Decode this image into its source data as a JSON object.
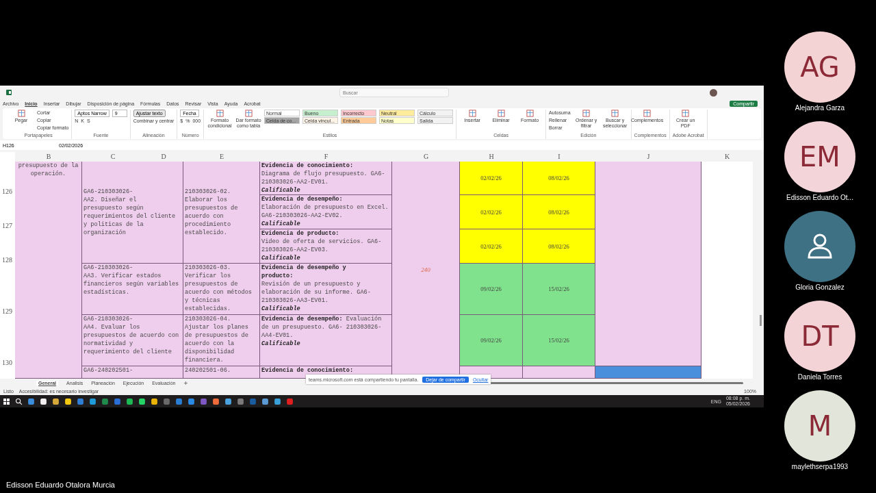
{
  "excel": {
    "search": {
      "placeholder": "Buscar"
    },
    "share_button": "Compartir",
    "menu_tabs": [
      {
        "label": "Archivo",
        "selected": false
      },
      {
        "label": "Inicio",
        "selected": true
      },
      {
        "label": "Insertar",
        "selected": false
      },
      {
        "label": "Dibujar",
        "selected": false
      },
      {
        "label": "Disposición de página",
        "selected": false
      },
      {
        "label": "Fórmulas",
        "selected": false
      },
      {
        "label": "Datos",
        "selected": false
      },
      {
        "label": "Revisar",
        "selected": false
      },
      {
        "label": "Vista",
        "selected": false
      },
      {
        "label": "Ayuda",
        "selected": false
      },
      {
        "label": "Acrobat",
        "selected": false
      }
    ],
    "ribbon": [
      {
        "label": "Portapapeles",
        "large": [
          {
            "label": "Pegar"
          }
        ],
        "lines": [
          {
            "items": [
              {
                "kind": "text",
                "label": "Cortar"
              }
            ]
          },
          {
            "items": [
              {
                "kind": "text",
                "label": "Copiar"
              }
            ]
          },
          {
            "items": [
              {
                "kind": "text",
                "label": "Copiar formato"
              }
            ]
          }
        ]
      },
      {
        "label": "Fuente",
        "lines": [
          {
            "items": [
              {
                "kind": "field",
                "label": "Aptos Narrow"
              },
              {
                "kind": "field",
                "label": "9"
              }
            ]
          },
          {
            "items": [
              {
                "kind": "text",
                "label": "N"
              },
              {
                "kind": "text",
                "label": "K"
              },
              {
                "kind": "text",
                "label": "S"
              }
            ]
          }
        ]
      },
      {
        "label": "Alineación",
        "lines": [
          {
            "items": [
              {
                "kind": "toggle",
                "label": "Ajustar texto"
              }
            ]
          },
          {
            "items": [
              {
                "kind": "text",
                "label": "Combinar y centrar"
              }
            ]
          }
        ]
      },
      {
        "label": "Número",
        "lines": [
          {
            "items": [
              {
                "kind": "field",
                "label": "Fecha"
              }
            ]
          },
          {
            "items": [
              {
                "kind": "text",
                "label": "$"
              },
              {
                "kind": "text",
                "label": "%"
              },
              {
                "kind": "text",
                "label": "000"
              }
            ]
          }
        ]
      },
      {
        "label": "Estilos",
        "large": [
          {
            "label": "Formato condicional"
          },
          {
            "label": "Dar formato como tabla"
          }
        ],
        "lines": [
          {
            "items": [
              {
                "kind": "style",
                "label": "Normal",
                "color": "#ffffff"
              },
              {
                "kind": "style",
                "label": "Bueno",
                "color": "#c6efce"
              },
              {
                "kind": "style",
                "label": "Incorrecto",
                "color": "#ffc7ce"
              },
              {
                "kind": "style",
                "label": "Neutral",
                "color": "#ffeb9c"
              },
              {
                "kind": "style",
                "label": "Cálculo",
                "color": "#f2f2f2"
              }
            ]
          },
          {
            "items": [
              {
                "kind": "style",
                "label": "Celda de co...",
                "color": "#a5a5a5"
              },
              {
                "kind": "style",
                "label": "Celda vincul...",
                "color": "#fdf3e7"
              },
              {
                "kind": "style",
                "label": "Entrada",
                "color": "#ffcc99"
              },
              {
                "kind": "style",
                "label": "Notas",
                "color": "#ffffcc"
              },
              {
                "kind": "style",
                "label": "Salida",
                "color": "#f2f2f2"
              }
            ]
          }
        ]
      },
      {
        "label": "Celdas",
        "large": [
          {
            "label": "Insertar"
          },
          {
            "label": "Eliminar"
          },
          {
            "label": "Formato"
          }
        ]
      },
      {
        "label": "Edición",
        "lines": [
          {
            "items": [
              {
                "kind": "text",
                "label": "Autosuma"
              }
            ]
          },
          {
            "items": [
              {
                "kind": "text",
                "label": "Rellenar"
              }
            ]
          },
          {
            "items": [
              {
                "kind": "text",
                "label": "Borrar"
              }
            ]
          }
        ],
        "large_after": [
          {
            "label": "Ordenar y filtrar"
          },
          {
            "label": "Buscar y seleccionar"
          }
        ]
      },
      {
        "label": "Complementos",
        "large": [
          {
            "label": "Complementos"
          }
        ]
      },
      {
        "label": "Adobe Acrobat",
        "large": [
          {
            "label": "Crear un PDF"
          }
        ]
      }
    ],
    "name_box": "H126",
    "formula": "02/02/2026",
    "sheet": {
      "columns": [
        "B",
        "C",
        "D",
        "E",
        "F",
        "G",
        "H",
        "I",
        "J",
        "K"
      ],
      "row_numbers": [
        "126",
        "127",
        "128",
        "129",
        "130"
      ],
      "outcome": "presupuesto de la\noperación.",
      "activities": [
        "GA6-210303026-\nAA2.  Diseñar el\npresupuesto según\nrequerimientos del cliente\ny politicas de la\norganización",
        "GA6-210303026-\nAA3. Verificar estados\nfinancieros según variables\nestadísticas.",
        "GA6-210303026-\nAA4. Evaluar los\npresupuestos de acuerdo con\nnormatividad y\nrequerimiento del cliente",
        "GA6-240202501-"
      ],
      "competencies": [
        "210303026-02.\nElaborar los\npresupuestos de\nacuerdo con\nprocedimiento\nestablecido.",
        "210303026-03.\nVerificar los\npresupuestos de\nacuerdo con métodos\ny técnicas\nestablecidas.",
        "210303026-04.\nAjustar los planes\nde presupuestos de\nacuerdo con la\ndisponibilidad\nfinanciera.",
        "240202501-06."
      ],
      "evidences": [
        {
          "text": "**Evidencia de conocimiento:**\nDiagrama de flujo presupuesto. GA6-\n210303026-AA2-EV01.",
          "note": "Calificable"
        },
        {
          "text": "**Evidencia de desempeño:**\nElaboración de presupuesto en Excel.\nGA6-210303026-AA2-EV02.",
          "note": "Calificable"
        },
        {
          "text": "**Evidencia de producto:**\nVideo de oferta de servicios. GA6-\n210303026-AA2-EV03.",
          "note": "Calificable"
        },
        {
          "text": "**Evidencia de desempeño y\nproducto:**\nRevisión de un presupuesto y\nelaboración de su informe. GA6-\n210303026-AA3-EV01.",
          "note": "Calificable"
        },
        {
          "text": "**Evidencia de desempeño:** Evaluación\nde un presupuesto. GA6- 210303026-\nAA4-EV01.",
          "note": "Calificable"
        },
        {
          "text": "**Evidencia de conocimiento:**"
        }
      ],
      "hours": "240",
      "start_dates": [
        {
          "text": "02/02/26",
          "color": "#ffff00"
        },
        {
          "text": "02/02/26",
          "color": "#ffff00"
        },
        {
          "text": "02/02/26",
          "color": "#ffff00"
        },
        {
          "text": "09/02/26",
          "color": "#80e28c"
        },
        {
          "text": "09/02/26",
          "color": "#80e28c"
        },
        {
          "color": "#efcdec"
        }
      ],
      "end_dates": [
        {
          "text": "08/02/26",
          "color": "#ffff00"
        },
        {
          "text": "08/02/26",
          "color": "#ffff00"
        },
        {
          "text": "08/02/26",
          "color": "#ffff00"
        },
        {
          "text": "15/02/26",
          "color": "#80e28c"
        },
        {
          "text": "15/02/26",
          "color": "#80e28c"
        },
        {
          "color": "#efcdec"
        }
      ],
      "column_j": [
        {
          "color": "#efcdec"
        },
        {
          "color": "#4a8fdc"
        }
      ]
    },
    "sheet_tabs": [
      {
        "label": "General",
        "selected": true
      },
      {
        "label": "Analisis",
        "selected": false
      },
      {
        "label": "Planeación",
        "selected": false
      },
      {
        "label": "Ejecución",
        "selected": false
      },
      {
        "label": "Evaluación",
        "selected": false
      }
    ],
    "status": "Listo",
    "accessibility": "Accesibilidad: es necesario investigar",
    "zoom": "100%",
    "sharing_bar": {
      "message": "teams.microsoft.com está compartiendo tu pantalla.",
      "stop_button": "Dejar de compartir",
      "hide_link": "Ocultar"
    }
  },
  "taskbar": {
    "apps": [
      {
        "color": "#3b8ede"
      },
      {
        "color": "#f0f0f0"
      },
      {
        "color": "#d6a83a"
      },
      {
        "color": "#f2c811"
      },
      {
        "color": "#2f7fd6"
      },
      {
        "color": "#1e9bd8"
      },
      {
        "color": "#1f8a4c"
      },
      {
        "color": "#2a6fd6"
      },
      {
        "color": "#1db954"
      },
      {
        "color": "#25d366"
      },
      {
        "color": "#e8b400"
      },
      {
        "color": "#6a6a6a"
      },
      {
        "color": "#2a7fd4"
      },
      {
        "color": "#2b8ae6"
      },
      {
        "color": "#7e57c2"
      },
      {
        "color": "#ef6c3a"
      },
      {
        "color": "#4aa3df"
      },
      {
        "color": "#7a7a7a"
      },
      {
        "color": "#1a5c9e"
      },
      {
        "color": "#5b9bd5"
      },
      {
        "color": "#3aa0d8"
      },
      {
        "color": "#e02020"
      }
    ],
    "language": "ENG",
    "time": "08:08 p. m.",
    "date": "05/02/2026"
  },
  "participants": [
    {
      "kind": "initials",
      "initials": "AG",
      "name": "Alejandra Garza",
      "color": "#f3d3d4"
    },
    {
      "kind": "initials",
      "initials": "EM",
      "name": "Edisson Eduardo Ot...",
      "color": "#f3d5d9"
    },
    {
      "kind": "silhouette",
      "name": "Gloria Gonzalez",
      "color": "#3e7184"
    },
    {
      "kind": "initials",
      "initials": "DT",
      "name": "Daniela Torres",
      "color": "#f3d3d6"
    },
    {
      "kind": "initials",
      "initials": "M",
      "name": "maylethserpa1993",
      "color": "#e2e6da"
    }
  ],
  "presenter": "Edisson Eduardo Otalora Murcia"
}
